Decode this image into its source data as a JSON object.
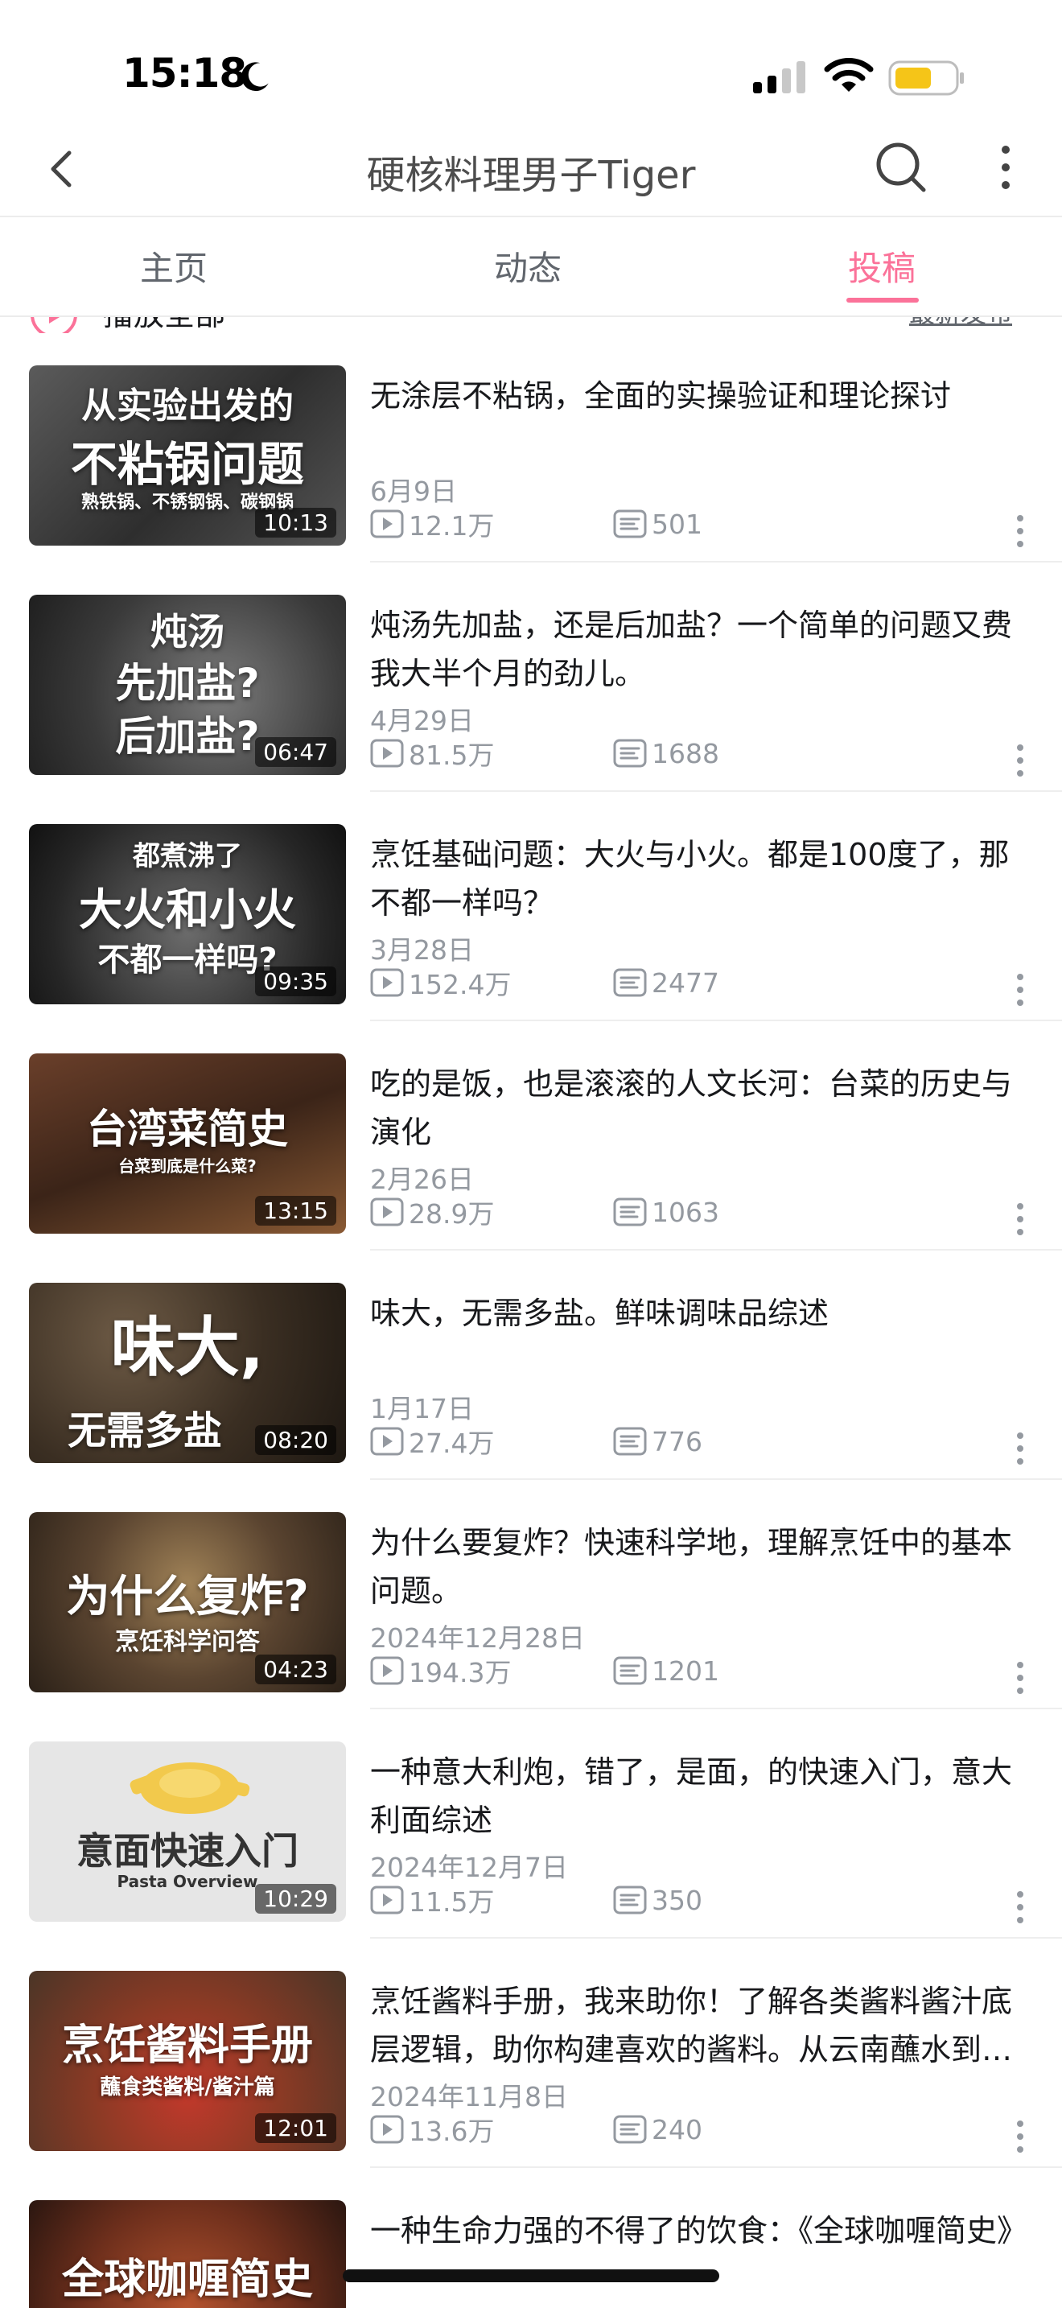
{
  "status_bar": {
    "time": "15:18"
  },
  "nav": {
    "title": "硬核料理男子Tiger"
  },
  "tabs": [
    {
      "label": "主页",
      "active": false
    },
    {
      "label": "动态",
      "active": false
    },
    {
      "label": "投稿",
      "active": true
    }
  ],
  "list_header": {
    "play_all": "播放全部",
    "sort": "最新发布"
  },
  "colors": {
    "accent": "#fb7299",
    "secondary_text": "#9499a0",
    "battery": "#f5c518"
  },
  "videos": [
    {
      "title": "无涂层不粘锅，全面的实操验证和理论探讨",
      "date": "6月9日",
      "views": "12.1万",
      "comments": "501",
      "duration": "10:13",
      "thumb_lines": [
        "从实验出发的",
        "不粘锅问题",
        "熟铁锅、不锈钢锅、碳钢锅"
      ]
    },
    {
      "title": "炖汤先加盐，还是后加盐？一个简单的问题又费我大半个月的劲儿。",
      "date": "4月29日",
      "views": "81.5万",
      "comments": "1688",
      "duration": "06:47",
      "thumb_lines": [
        "炖汤",
        "先加盐?",
        "后加盐?"
      ]
    },
    {
      "title": "烹饪基础问题：大火与小火。都是100度了，那不都一样吗？",
      "date": "3月28日",
      "views": "152.4万",
      "comments": "2477",
      "duration": "09:35",
      "thumb_lines": [
        "都煮沸了",
        "大火和小火",
        "不都一样吗?"
      ]
    },
    {
      "title": "吃的是饭，也是滚滚的人文长河：台菜的历史与演化",
      "date": "2月26日",
      "views": "28.9万",
      "comments": "1063",
      "duration": "13:15",
      "thumb_lines": [
        "台湾菜简史",
        "台菜到底是什么菜?"
      ]
    },
    {
      "title": "味大，无需多盐。鲜味调味品综述",
      "date": "1月17日",
      "views": "27.4万",
      "comments": "776",
      "duration": "08:20",
      "thumb_lines": [
        "味大,",
        "无需多盐"
      ]
    },
    {
      "title": "为什么要复炸？快速科学地，理解烹饪中的基本问题。",
      "date": "2024年12月28日",
      "views": "194.3万",
      "comments": "1201",
      "duration": "04:23",
      "thumb_lines": [
        "为什么复炸?",
        "烹饪科学问答"
      ]
    },
    {
      "title": "一种意大利炮，错了，是面，的快速入门，意大利面综述",
      "date": "2024年12月7日",
      "views": "11.5万",
      "comments": "350",
      "duration": "10:29",
      "thumb_lines": [
        "意面快速入门",
        "Pasta Overview"
      ]
    },
    {
      "title": "烹饪酱料手册，我来助你！了解各类酱料酱汁底层逻辑，助你构建喜欢的酱料。从云南蘸水到西式酱汁",
      "date": "2024年11月8日",
      "views": "13.6万",
      "comments": "240",
      "duration": "12:01",
      "thumb_lines": [
        "烹饪酱料手册",
        "蘸食类酱料/酱汁篇"
      ]
    },
    {
      "title": "一种生命力强的不得了的饮食：《全球咖喱简史》",
      "date": "",
      "views": "",
      "comments": "",
      "duration": "",
      "thumb_lines": [
        "全球咖喱简史"
      ]
    }
  ]
}
